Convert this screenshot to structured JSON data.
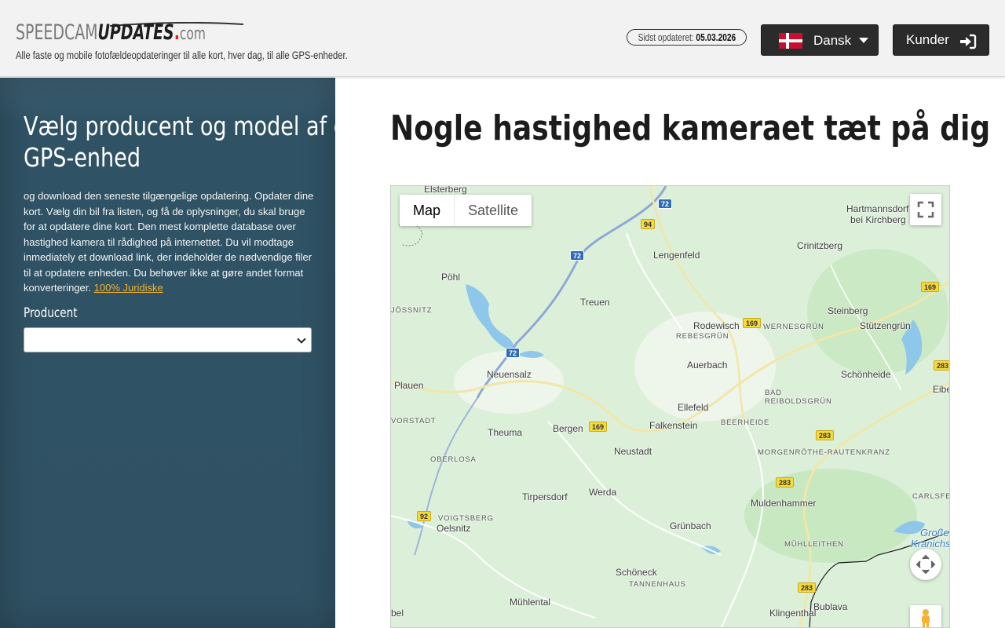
{
  "header": {
    "logo": {
      "part1": "SPEEDCAM",
      "part2": "UPDATES",
      "dot": ".",
      "part3": "com"
    },
    "tagline": "Alle faste og mobile fotofældeopdateringer til alle kort, hver dag, til alle GPS-enheder.",
    "updated_label": "Sidst opdateret:",
    "updated_date": "05.03.2026",
    "language": {
      "label": "Dansk",
      "flag": "denmark-flag"
    },
    "customers_label": "Kunder"
  },
  "sidebar": {
    "title_line1": "Vælg producent og model af din",
    "title_line2": "GPS-enhed",
    "description": "og download den seneste tilgængelige opdatering. Opdater dine kort. Vælg din bil fra listen, og få de oplysninger, du skal bruge for at opdatere dine kort. Den mest komplette database over hastighed kamera til rådighed på internettet. Du vil modtage inmediately et download link, der indeholder de nødvendige filer til at opdatere enheden. Du behøver ikke at gøre andet format konverteringer.",
    "legal_link": "100% Juridiske",
    "producer_label": "Producent",
    "producer_value": ""
  },
  "main": {
    "title": "Nogle hastighed kameraet tæt på dig"
  },
  "map": {
    "type_options": [
      "Map",
      "Satellite"
    ],
    "active_type": "Map",
    "places": [
      {
        "name": "Elsterberg",
        "cls": ""
      },
      {
        "name": "Pöhl",
        "cls": ""
      },
      {
        "name": "Lengenfeld",
        "cls": ""
      },
      {
        "name": "Hartmannsdorf",
        "cls": ""
      },
      {
        "name": "bei Kirchberg",
        "cls": ""
      },
      {
        "name": "Crinitzberg",
        "cls": ""
      },
      {
        "name": "JÖSSNITZ",
        "cls": "caps"
      },
      {
        "name": "Treuen",
        "cls": ""
      },
      {
        "name": "Rodewisch",
        "cls": ""
      },
      {
        "name": "WERNESGRÜN",
        "cls": "caps"
      },
      {
        "name": "Steinberg",
        "cls": ""
      },
      {
        "name": "Stützengrün",
        "cls": ""
      },
      {
        "name": "REBESGRÜN",
        "cls": "caps"
      },
      {
        "name": "Auerbach",
        "cls": ""
      },
      {
        "name": "Neuensalz",
        "cls": ""
      },
      {
        "name": "Schönheide",
        "cls": ""
      },
      {
        "name": "Plauen",
        "cls": ""
      },
      {
        "name": "Eibenstock",
        "cls": ""
      },
      {
        "name": "BAD",
        "cls": "caps"
      },
      {
        "name": "REIBOLDSGRÜN",
        "cls": "caps"
      },
      {
        "name": "Ellefeld",
        "cls": ""
      },
      {
        "name": "VORSTADT",
        "cls": "caps"
      },
      {
        "name": "BEERHEIDE",
        "cls": "caps"
      },
      {
        "name": "Falkenstein",
        "cls": ""
      },
      {
        "name": "Theuma",
        "cls": ""
      },
      {
        "name": "Bergen",
        "cls": ""
      },
      {
        "name": "Neustadt",
        "cls": ""
      },
      {
        "name": "MORGENRÖTHE-RAUTENKRANZ",
        "cls": "caps"
      },
      {
        "name": "OBERLOSA",
        "cls": "caps"
      },
      {
        "name": "Tirpersdorf",
        "cls": ""
      },
      {
        "name": "Werda",
        "cls": ""
      },
      {
        "name": "CARLSFELD",
        "cls": "caps"
      },
      {
        "name": "Muldenhammer",
        "cls": ""
      },
      {
        "name": "VOIGTSBERG",
        "cls": "caps"
      },
      {
        "name": "Oelsnitz",
        "cls": ""
      },
      {
        "name": "Grünbach",
        "cls": ""
      },
      {
        "name": "Große",
        "cls": "water"
      },
      {
        "name": "Kranichs",
        "cls": "water"
      },
      {
        "name": "MÜHLLEITHEN",
        "cls": "caps"
      },
      {
        "name": "Schöneck",
        "cls": ""
      },
      {
        "name": "TANNENHAUS",
        "cls": "caps"
      },
      {
        "name": "Mühlental",
        "cls": ""
      },
      {
        "name": "Bublava",
        "cls": ""
      },
      {
        "name": "Klingenthal",
        "cls": ""
      },
      {
        "name": "bel",
        "cls": ""
      }
    ],
    "shields": [
      {
        "label": "72",
        "cls": "b"
      },
      {
        "label": "94",
        "cls": "y"
      },
      {
        "label": "72",
        "cls": "b"
      },
      {
        "label": "169",
        "cls": "y"
      },
      {
        "label": "169",
        "cls": "y"
      },
      {
        "label": "72",
        "cls": "b"
      },
      {
        "label": "283",
        "cls": "y"
      },
      {
        "label": "169",
        "cls": "y"
      },
      {
        "label": "283",
        "cls": "y"
      },
      {
        "label": "283",
        "cls": "y"
      },
      {
        "label": "92",
        "cls": "y"
      },
      {
        "label": "283",
        "cls": "y"
      }
    ]
  }
}
